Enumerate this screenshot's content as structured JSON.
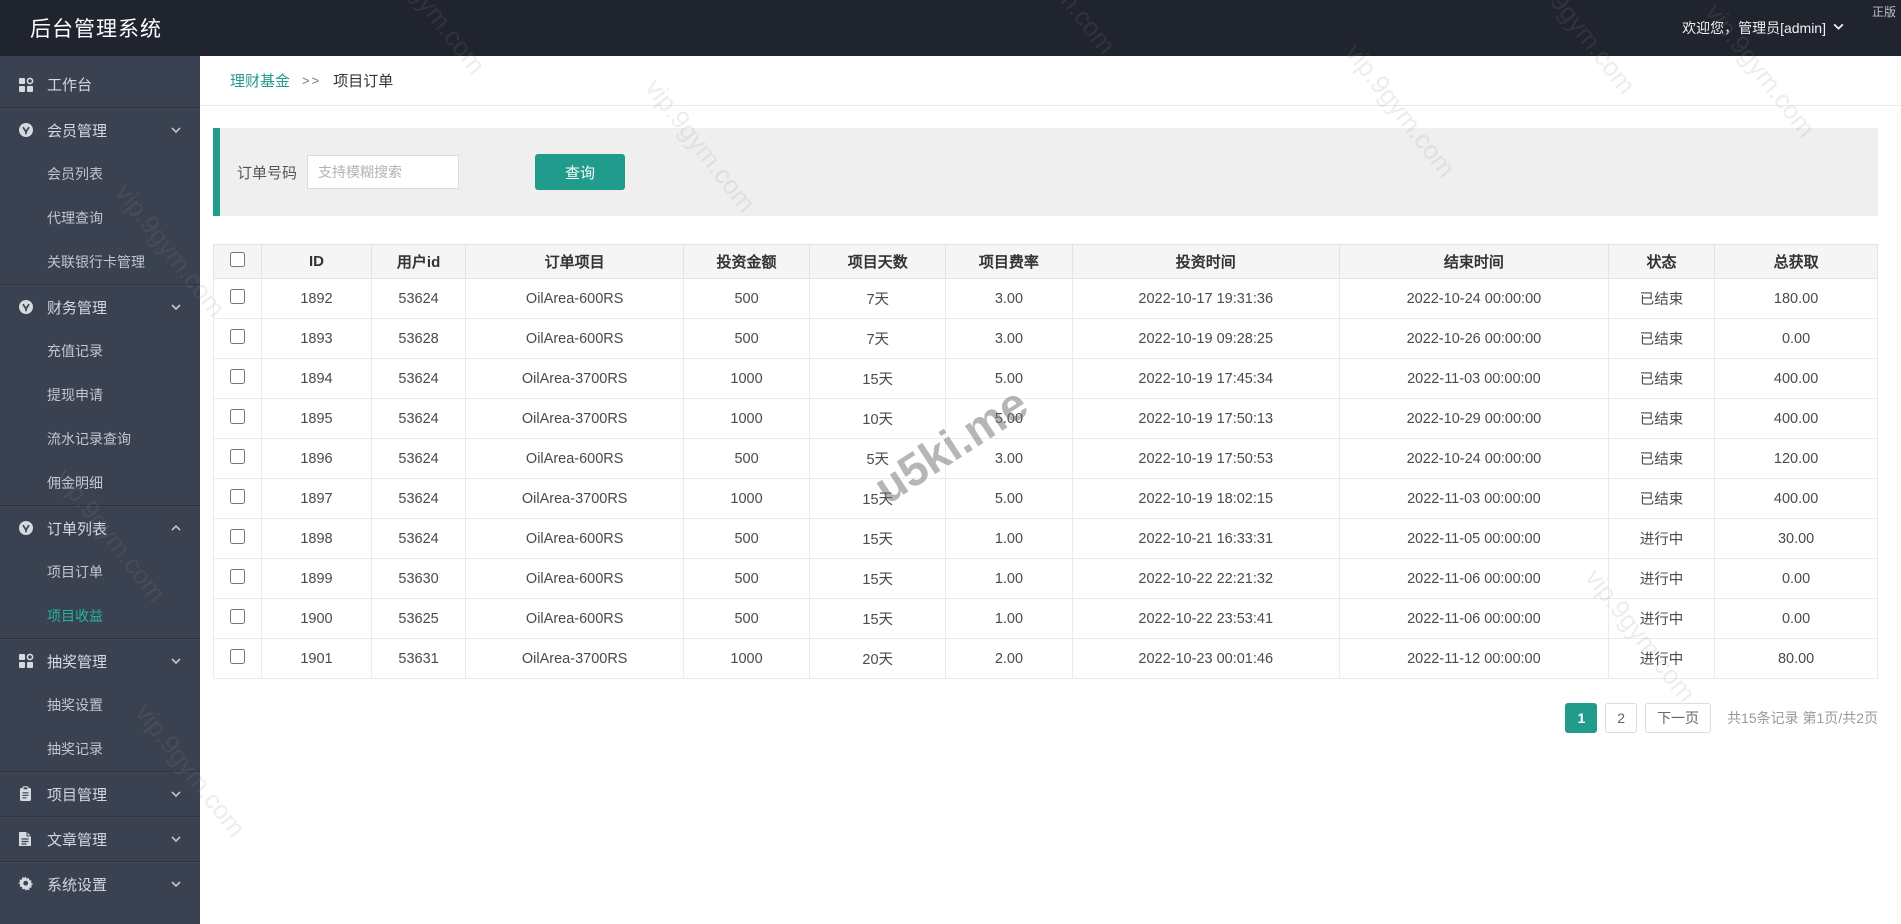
{
  "topbar": {
    "title": "后台管理系统",
    "welcome": "欢迎您，管理员[admin]",
    "corner_tag": "正版"
  },
  "sidebar": {
    "items": [
      {
        "name": "workbench",
        "label": "工作台",
        "type": "top",
        "icon": "grid-icon"
      },
      {
        "name": "member-management",
        "label": "会员管理",
        "type": "top",
        "icon": "badge-icon",
        "chevron": "down"
      },
      {
        "name": "member-list",
        "label": "会员列表",
        "type": "sub"
      },
      {
        "name": "agent-query",
        "label": "代理查询",
        "type": "sub"
      },
      {
        "name": "bank-card-management",
        "label": "关联银行卡管理",
        "type": "sub"
      },
      {
        "name": "finance-management",
        "label": "财务管理",
        "type": "top",
        "icon": "badge-icon",
        "chevron": "down"
      },
      {
        "name": "recharge-records",
        "label": "充值记录",
        "type": "sub"
      },
      {
        "name": "withdrawal-requests",
        "label": "提现申请",
        "type": "sub"
      },
      {
        "name": "transaction-records",
        "label": "流水记录查询",
        "type": "sub"
      },
      {
        "name": "commission-details",
        "label": "佣金明细",
        "type": "sub"
      },
      {
        "name": "order-list",
        "label": "订单列表",
        "type": "top",
        "icon": "badge-icon",
        "chevron": "up"
      },
      {
        "name": "project-orders",
        "label": "项目订单",
        "type": "sub"
      },
      {
        "name": "project-earnings",
        "label": "项目收益",
        "type": "sub",
        "active": true
      },
      {
        "name": "lottery-management",
        "label": "抽奖管理",
        "type": "top",
        "icon": "grid-icon",
        "chevron": "down"
      },
      {
        "name": "lottery-settings",
        "label": "抽奖设置",
        "type": "sub"
      },
      {
        "name": "lottery-records",
        "label": "抽奖记录",
        "type": "sub"
      },
      {
        "name": "project-management",
        "label": "项目管理",
        "type": "top",
        "icon": "clipboard-icon",
        "chevron": "down"
      },
      {
        "name": "article-management",
        "label": "文章管理",
        "type": "top",
        "icon": "file-icon",
        "chevron": "down"
      },
      {
        "name": "system-settings",
        "label": "系统设置",
        "type": "top",
        "icon": "gear-icon",
        "chevron": "down"
      }
    ]
  },
  "breadcrumb": {
    "parent": "理财基金",
    "separator": ">>",
    "current": "项目订单"
  },
  "search": {
    "label": "订单号码",
    "placeholder": "支持模糊搜索",
    "button": "查询"
  },
  "table": {
    "columns": [
      "ID",
      "用户id",
      "订单项目",
      "投资金额",
      "项目天数",
      "项目费率",
      "投资时间",
      "结束时间",
      "状态",
      "总获取"
    ],
    "rows": [
      [
        "1892",
        "53624",
        "OilArea-600RS",
        "500",
        "7天",
        "3.00",
        "2022-10-17 19:31:36",
        "2022-10-24 00:00:00",
        "已结束",
        "180.00"
      ],
      [
        "1893",
        "53628",
        "OilArea-600RS",
        "500",
        "7天",
        "3.00",
        "2022-10-19 09:28:25",
        "2022-10-26 00:00:00",
        "已结束",
        "0.00"
      ],
      [
        "1894",
        "53624",
        "OilArea-3700RS",
        "1000",
        "15天",
        "5.00",
        "2022-10-19 17:45:34",
        "2022-11-03 00:00:00",
        "已结束",
        "400.00"
      ],
      [
        "1895",
        "53624",
        "OilArea-3700RS",
        "1000",
        "10天",
        "5.00",
        "2022-10-19 17:50:13",
        "2022-10-29 00:00:00",
        "已结束",
        "400.00"
      ],
      [
        "1896",
        "53624",
        "OilArea-600RS",
        "500",
        "5天",
        "3.00",
        "2022-10-19 17:50:53",
        "2022-10-24 00:00:00",
        "已结束",
        "120.00"
      ],
      [
        "1897",
        "53624",
        "OilArea-3700RS",
        "1000",
        "15天",
        "5.00",
        "2022-10-19 18:02:15",
        "2022-11-03 00:00:00",
        "已结束",
        "400.00"
      ],
      [
        "1898",
        "53624",
        "OilArea-600RS",
        "500",
        "15天",
        "1.00",
        "2022-10-21 16:33:31",
        "2022-11-05 00:00:00",
        "进行中",
        "30.00"
      ],
      [
        "1899",
        "53630",
        "OilArea-600RS",
        "500",
        "15天",
        "1.00",
        "2022-10-22 22:21:32",
        "2022-11-06 00:00:00",
        "进行中",
        "0.00"
      ],
      [
        "1900",
        "53625",
        "OilArea-600RS",
        "500",
        "15天",
        "1.00",
        "2022-10-22 23:53:41",
        "2022-11-06 00:00:00",
        "进行中",
        "0.00"
      ],
      [
        "1901",
        "53631",
        "OilArea-3700RS",
        "1000",
        "20天",
        "2.00",
        "2022-10-23 00:01:46",
        "2022-11-12 00:00:00",
        "进行中",
        "80.00"
      ]
    ]
  },
  "pagination": {
    "pages": [
      "1",
      "2"
    ],
    "active_page": "1",
    "next_label": "下一页",
    "summary": "共15条记录 第1页/共2页"
  },
  "watermarks": {
    "repeat_text": "vip.9gym.com",
    "big_text": "u5ki.me"
  },
  "colors": {
    "accent": "#219b8c",
    "topbar_bg": "#20242e",
    "sidebar_bg": "#3a4150",
    "active_menu_text": "#22b79c",
    "table_header_bg": "#f5f5f5"
  }
}
